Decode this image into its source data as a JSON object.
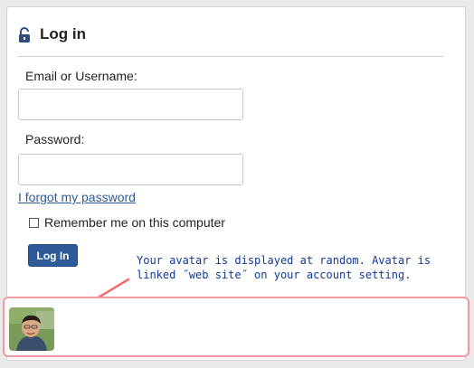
{
  "login": {
    "title": "Log in",
    "email_label": "Email or Username:",
    "email_value": "",
    "password_label": "Password:",
    "password_value": "",
    "forgot_link": "I forgot my password",
    "remember_label": "Remember me on this computer",
    "remember_checked": false,
    "submit_label": "Log In"
  },
  "annotation": {
    "line1": "Your avatar is displayed at random. Avatar is",
    "line2": "linked ˝web site˝ on your account setting.",
    "color": "#0f3a9a"
  },
  "avatar_panel": {
    "highlight_color": "#f09aa0",
    "arrow_color": "#f26b73"
  },
  "icons": {
    "lock": "lock-icon",
    "avatar": "avatar"
  },
  "colors": {
    "accent": "#2e5a9a",
    "link": "#2d5c97"
  }
}
